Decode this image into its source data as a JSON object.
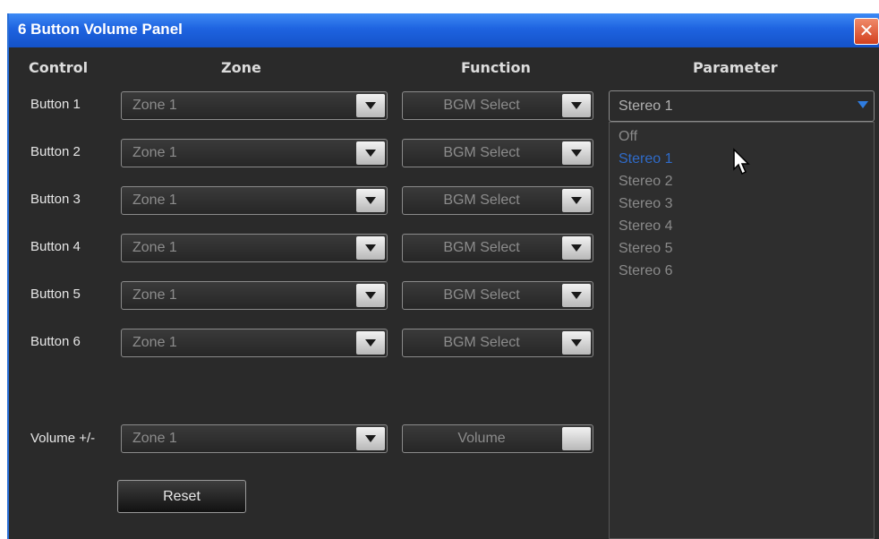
{
  "window": {
    "title": "6 Button Volume Panel",
    "close_glyph": "✕"
  },
  "headers": {
    "control": "Control",
    "zone": "Zone",
    "function": "Function",
    "parameter": "Parameter"
  },
  "rows": [
    {
      "label": "Button 1",
      "zone": "Zone 1",
      "function": "BGM Select"
    },
    {
      "label": "Button 2",
      "zone": "Zone 1",
      "function": "BGM Select"
    },
    {
      "label": "Button 3",
      "zone": "Zone 1",
      "function": "BGM Select"
    },
    {
      "label": "Button 4",
      "zone": "Zone 1",
      "function": "BGM Select"
    },
    {
      "label": "Button 5",
      "zone": "Zone 1",
      "function": "BGM Select"
    },
    {
      "label": "Button 6",
      "zone": "Zone 1",
      "function": "BGM Select"
    }
  ],
  "volume_row": {
    "label": "Volume +/-",
    "zone": "Zone 1",
    "function": "Volume"
  },
  "parameter": {
    "selected": "Stereo 1",
    "options": [
      "Off",
      "Stereo 1",
      "Stereo 2",
      "Stereo 3",
      "Stereo 4",
      "Stereo 5",
      "Stereo 6"
    ]
  },
  "reset_label": "Reset",
  "colors": {
    "titlebar": "#1e63e0",
    "panel_bg": "#2a2a2a",
    "selected_option": "#2f6bc9",
    "arrow_accent": "#2f7de1"
  }
}
